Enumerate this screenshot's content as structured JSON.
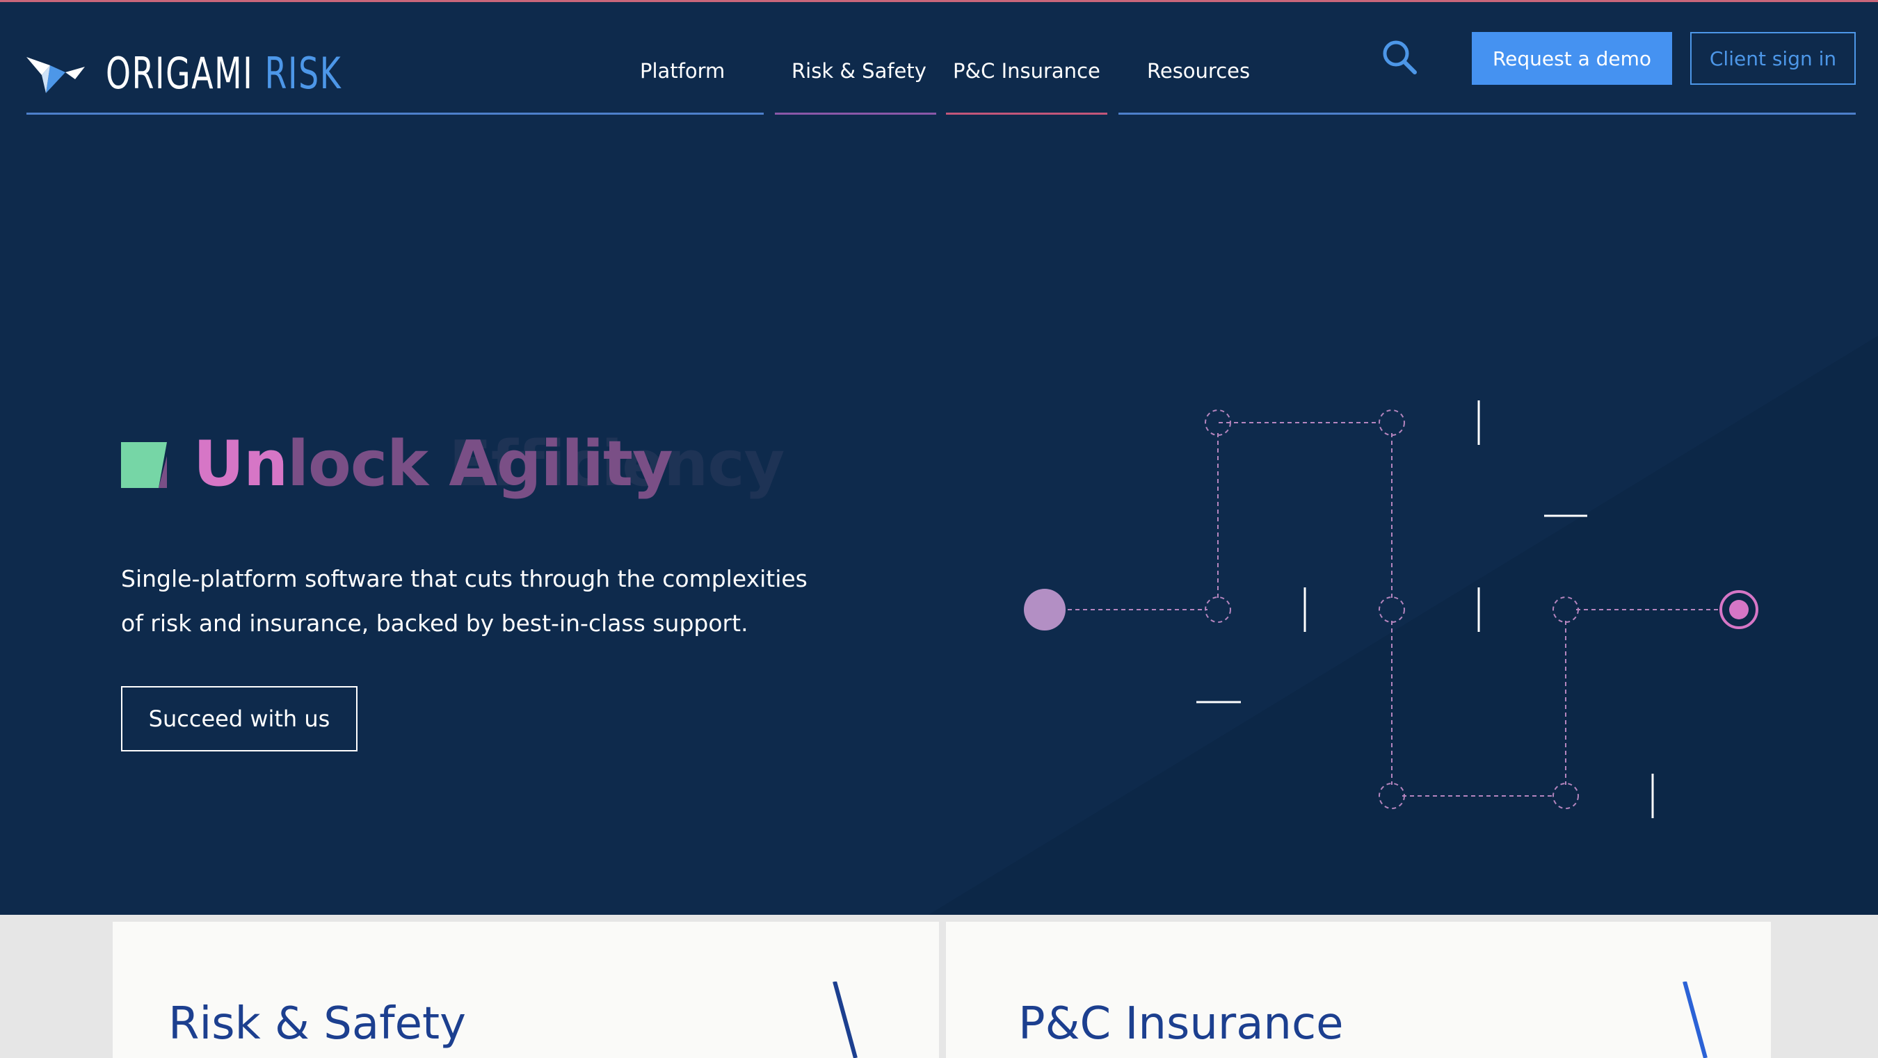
{
  "header": {
    "logo": {
      "word1": "ORIGAMI",
      "word2": "RISK"
    },
    "nav": [
      {
        "label": "Platform"
      },
      {
        "label": "Risk & Safety"
      },
      {
        "label": "P&C Insurance"
      },
      {
        "label": "Resources"
      }
    ],
    "search_icon": "search-icon",
    "request_demo_label": "Request a demo",
    "client_signin_label": "Client sign in"
  },
  "hero": {
    "headline_highlight": "Un",
    "headline_rest": "lock Agility",
    "headline_ghost": "Unlock Efficiency",
    "subtext": "Single-platform software that cuts through the complexities of risk and insurance, backed by best-in-class support.",
    "cta_label": "Succeed with us"
  },
  "cards": [
    {
      "title": "Risk & Safety"
    },
    {
      "title": "P&C Insurance"
    }
  ],
  "colors": {
    "hero_bg": "#0e2a4c",
    "accent_blue": "#4592f1",
    "accent_pink": "#d676c6",
    "card_title": "#1c3f8f"
  }
}
